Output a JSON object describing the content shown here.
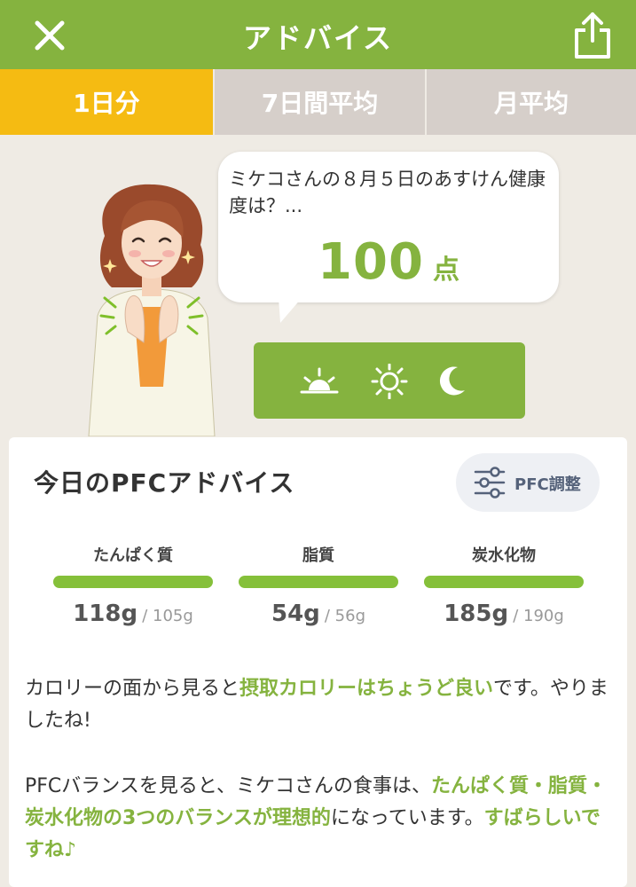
{
  "header": {
    "title": "アドバイス",
    "close_icon": "close-icon",
    "share_icon": "share-icon"
  },
  "tabs": [
    {
      "label": "1日分",
      "active": true
    },
    {
      "label": "7日間平均",
      "active": false
    },
    {
      "label": "月平均",
      "active": false
    }
  ],
  "bubble": {
    "question": "ミケコさんの８月５日のあすけん健康度は？...",
    "score": "100",
    "unit": "点"
  },
  "time_selector": {
    "icons": [
      "sunrise-icon",
      "sun-icon",
      "moon-icon"
    ]
  },
  "pfc": {
    "title": "今日のPFCアドバイス",
    "adjust_label": "PFC調整",
    "metrics": [
      {
        "name": "たんぱく質",
        "value": "118g",
        "target": "/ 105g",
        "progress": 1.0
      },
      {
        "name": "脂質",
        "value": "54g",
        "target": "/ 56g",
        "progress": 1.0
      },
      {
        "name": "炭水化物",
        "value": "185g",
        "target": "/ 190g",
        "progress": 1.0
      }
    ]
  },
  "advice": {
    "p1_pre": "カロリーの面から見ると",
    "p1_hl": "摂取カロリーはちょうど良い",
    "p1_post": "です。やりましたね!",
    "p2_pre": "PFCバランスを見ると、ミケコさんの食事は、",
    "p2_hl1": "たんぱく質・脂質・炭水化物の3つのバランスが理想的",
    "p2_mid": "になっています。",
    "p2_hl2": "すばらしいですね♪"
  },
  "colors": {
    "primary_green": "#85b33f",
    "active_tab": "#f5bb12",
    "inactive_tab": "#d6cfca",
    "bar_green": "#85c03a",
    "background": "#efebe4"
  }
}
